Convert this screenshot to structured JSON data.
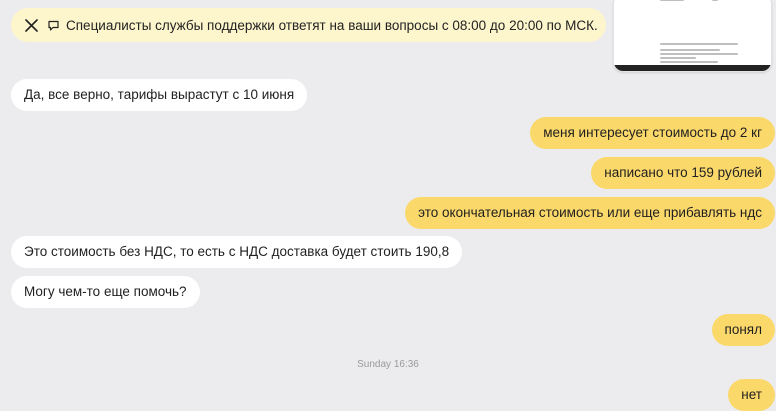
{
  "banner": {
    "text": "Специалисты службы поддержки ответят на ваши вопросы с 08:00 до 20:00 по МСК.",
    "close_icon": "close-icon",
    "info_icon": "speech-icon",
    "background": "#fdf5cc"
  },
  "colors": {
    "page_bg": "#ececee",
    "incoming_bubble": "#ffffff",
    "outgoing_bubble": "#fbd86a"
  },
  "messages": [
    {
      "direction": "incoming",
      "text": "Да, все верно, тарифы вырастут с 10 июня"
    },
    {
      "direction": "outgoing",
      "text": "меня интересует стоимость до 2 кг"
    },
    {
      "direction": "outgoing",
      "text": "написано что 159 рублей"
    },
    {
      "direction": "outgoing",
      "text": "это окончательная стоимость или еще прибавлять ндс"
    },
    {
      "direction": "incoming",
      "text": "Это стоимость без НДС, то есть с НДС доставка будет стоить 190,8"
    },
    {
      "direction": "incoming",
      "text": "Могу чем-то еще помочь?"
    },
    {
      "direction": "outgoing",
      "text": "понял"
    },
    {
      "direction": "outgoing",
      "text": "нет"
    }
  ],
  "day_separator": "Sunday 16:36"
}
